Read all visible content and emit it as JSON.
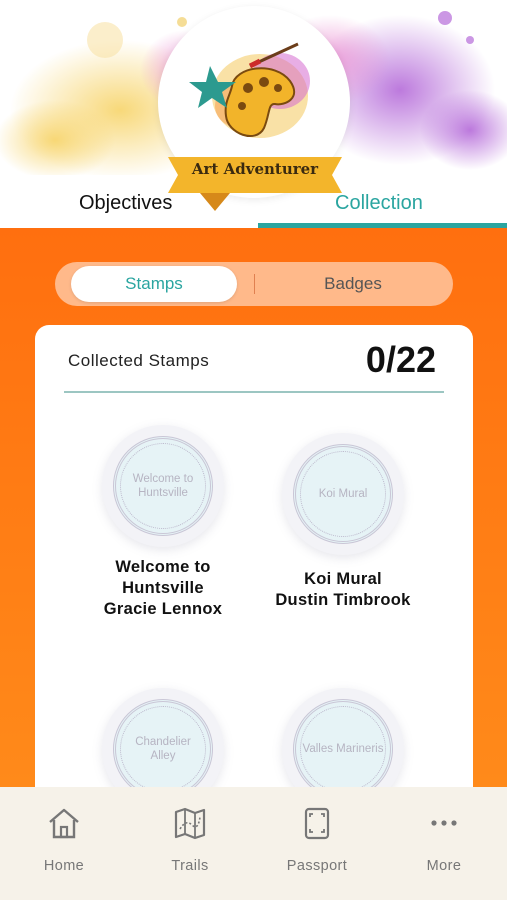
{
  "app": {
    "logo_title": "Art Adventurer"
  },
  "tabs": [
    {
      "label": "Objectives",
      "active": false
    },
    {
      "label": "Collection",
      "active": true
    }
  ],
  "segment": {
    "stamps_label": "Stamps",
    "badges_label": "Badges",
    "selected": "Stamps"
  },
  "card": {
    "title": "Collected Stamps",
    "count": "0/22"
  },
  "stamps": [
    {
      "stamp_text": "Welcome to Huntsville",
      "label_line1": "Welcome to",
      "label_line2": "Huntsville",
      "label_line3": "Gracie Lennox"
    },
    {
      "stamp_text": "Koi Mural",
      "label_line1": "Koi Mural",
      "label_line2": "Dustin Timbrook"
    },
    {
      "stamp_text": "Chandelier Alley"
    },
    {
      "stamp_text": "Valles Marineris"
    }
  ],
  "bottom_nav": [
    {
      "label": "Home",
      "icon": "home-icon"
    },
    {
      "label": "Trails",
      "icon": "map-icon"
    },
    {
      "label": "Passport",
      "icon": "passport-icon"
    },
    {
      "label": "More",
      "icon": "more-icon"
    }
  ],
  "colors": {
    "accent": "#2aa5a0",
    "orange": "#ff7a14",
    "nav_bg": "#f6f2e9"
  }
}
